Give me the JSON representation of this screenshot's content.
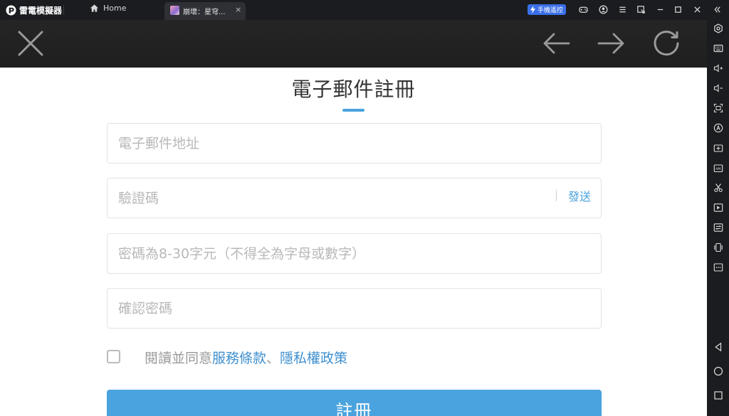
{
  "titlebar": {
    "brand_name": "雷電模擬器",
    "home_tab_label": "Home",
    "game_tab_label": "崩壞：星穹...",
    "game_tab_close": "×",
    "phone_control_label": "手機遙控",
    "icons": [
      "gamepad-icon",
      "account-icon",
      "menu-icon",
      "window-pin-icon",
      "minimize-icon",
      "maximize-icon",
      "close-icon",
      "collapse-sidebar-icon"
    ]
  },
  "sidebar": {
    "icons": [
      "settings-hex-icon",
      "keyboard-icon",
      "volume-up-icon",
      "volume-down-icon",
      "screenshot-icon",
      "macro-a-icon",
      "add-screen-icon",
      "apk-install-icon",
      "scissors-icon",
      "record-video-icon",
      "sync-icon",
      "shake-icon",
      "more-icon",
      "android-back-icon",
      "android-home-icon",
      "android-recent-icon"
    ]
  },
  "webbar": {
    "icons": [
      "close-x-icon",
      "back-arrow-icon",
      "forward-arrow-icon",
      "refresh-icon"
    ]
  },
  "form": {
    "title": "電子郵件註冊",
    "email_placeholder": "電子郵件地址",
    "code_placeholder": "驗證碼",
    "send_label": "發送",
    "password_placeholder": "密碼為8-30字元（不得全為字母或數字）",
    "confirm_placeholder": "確認密碼",
    "agree_prefix": "閱讀並同意",
    "terms_link": "服務條款",
    "separator": "、",
    "privacy_link": "隱私權政策",
    "submit_label": "註冊"
  },
  "colors": {
    "accent": "#4aa3de",
    "link": "#3e8fcf",
    "titlebar_bg": "#1b1c1f",
    "webbar_bg": "#222222",
    "phone_control_bg": "#3a6fe8"
  }
}
